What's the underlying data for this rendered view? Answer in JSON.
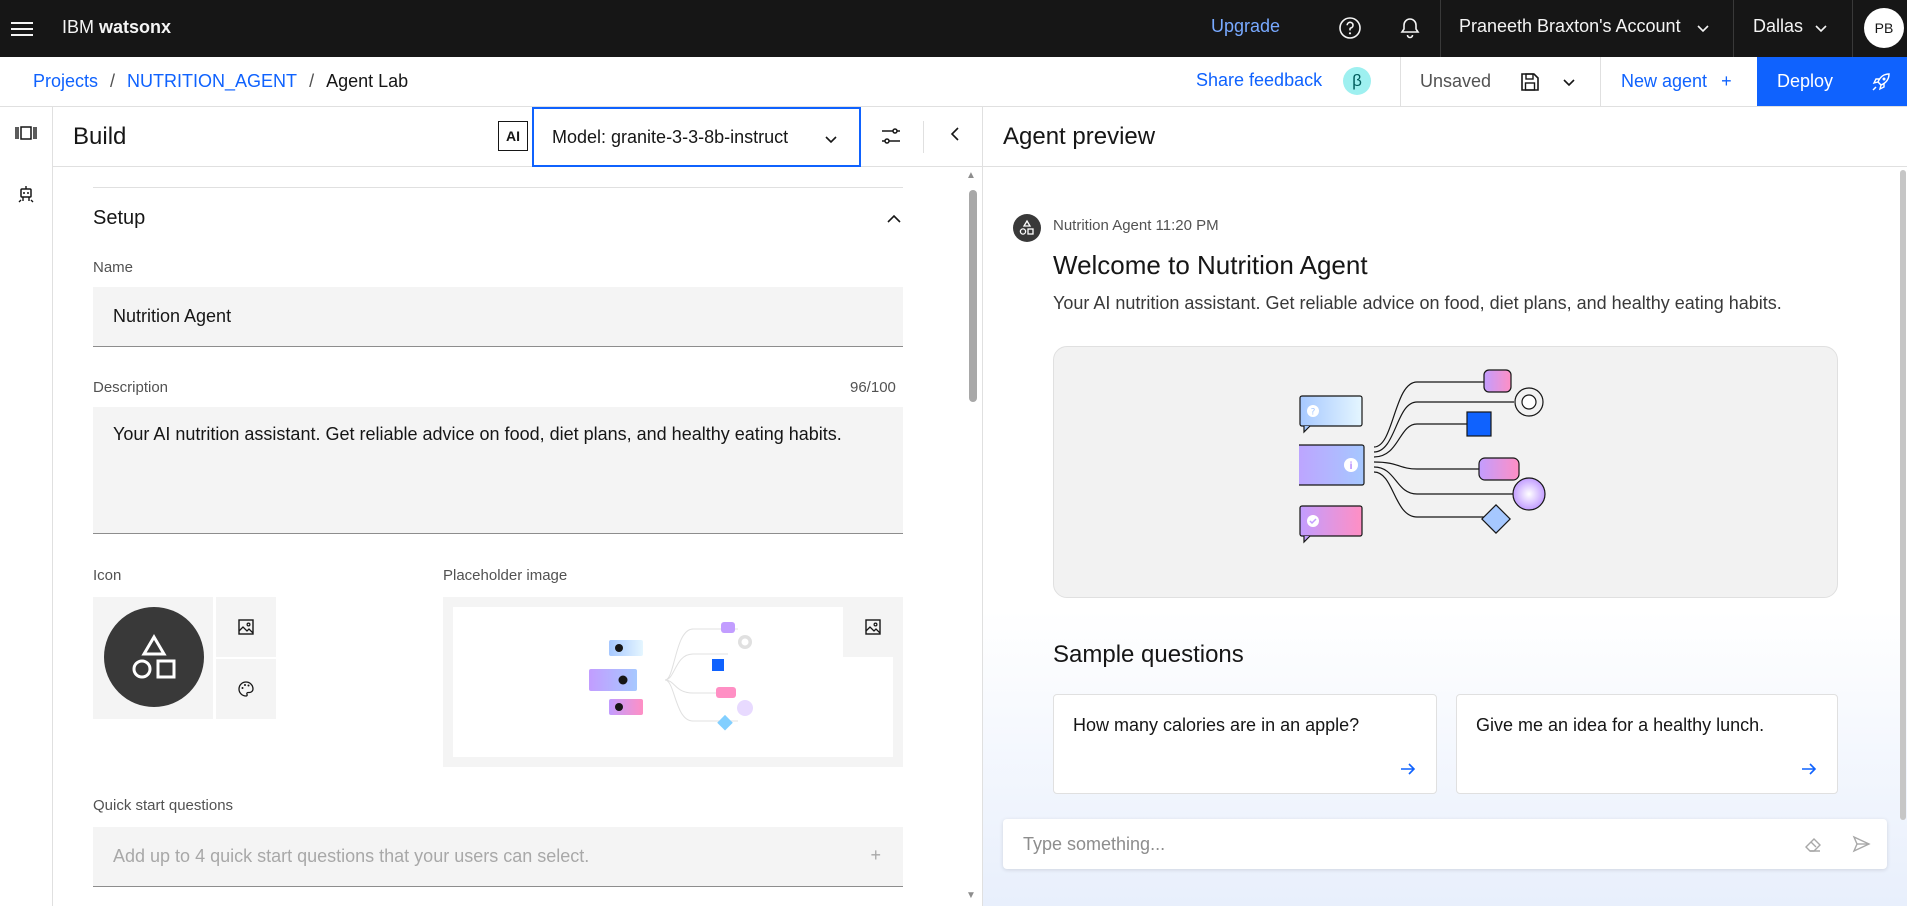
{
  "header": {
    "brand_prefix": "IBM",
    "brand_name": "watsonx",
    "upgrade": "Upgrade",
    "account": "Praneeth Braxton's Account",
    "region": "Dallas",
    "avatar_initials": "PB"
  },
  "breadcrumb": {
    "items": [
      "Projects",
      "NUTRITION_AGENT",
      "Agent Lab"
    ],
    "separator": "/"
  },
  "toolbar": {
    "share_feedback": "Share feedback",
    "beta": "β",
    "status": "Unsaved",
    "new_agent": "New agent",
    "new_agent_plus": "+",
    "deploy": "Deploy"
  },
  "build": {
    "title": "Build",
    "ai_badge": "AI",
    "model_label": "Model: granite-3-3-8b-instruct",
    "setup": {
      "title": "Setup",
      "name_label": "Name",
      "name_value": "Nutrition Agent",
      "description_label": "Description",
      "description_counter": "96/100",
      "description_value": "Your AI nutrition assistant. Get reliable advice on food, diet plans, and healthy eating habits.",
      "icon_label": "Icon",
      "placeholder_image_label": "Placeholder image",
      "quick_start_label": "Quick start questions",
      "quick_start_placeholder": "Add up to 4 quick start questions that your users can select.",
      "quick_start_add": "+"
    }
  },
  "preview": {
    "title": "Agent preview",
    "message_meta": "Nutrition Agent 11:20 PM",
    "welcome_title": "Welcome to Nutrition Agent",
    "welcome_desc": "Your AI nutrition assistant. Get reliable advice on food, diet plans, and healthy eating habits.",
    "sample_questions_title": "Sample questions",
    "sample_questions": [
      "How many calories are in an apple?",
      "Give me an idea for a healthy lunch."
    ],
    "input_placeholder": "Type something..."
  },
  "colors": {
    "header_bg": "#161616",
    "accent": "#0f62fe",
    "upgrade": "#78a9ff",
    "beta_bg": "#9ef0f0",
    "field_bg": "#f4f4f4"
  },
  "icons": [
    "menu-icon",
    "help-icon",
    "notification-icon",
    "chevron-down-icon",
    "save-icon",
    "rocket-icon",
    "tune-icon",
    "chevron-left-icon",
    "chevron-up-icon",
    "image-icon",
    "palette-icon",
    "arrow-right-icon",
    "eraser-icon",
    "send-icon",
    "agent-shapes-icon"
  ]
}
